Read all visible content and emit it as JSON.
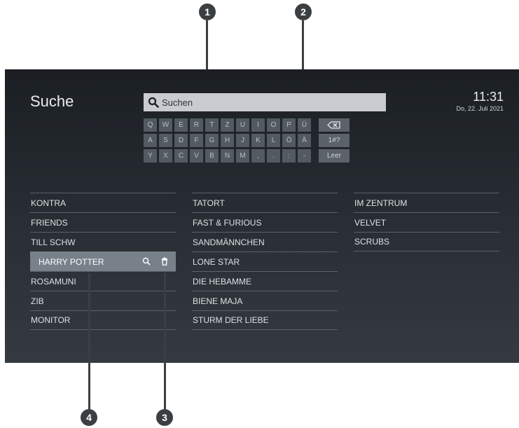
{
  "screen": {
    "title": "Suche",
    "clock": {
      "time": "11:31",
      "date": "Do, 22. Juli 2021"
    },
    "search": {
      "placeholder": "Suchen",
      "icon": "search-icon"
    },
    "keyboard": {
      "rows": [
        [
          "Q",
          "W",
          "E",
          "R",
          "T",
          "Z",
          "U",
          "I",
          "O",
          "P",
          "Ü"
        ],
        [
          "A",
          "S",
          "D",
          "F",
          "G",
          "H",
          "J",
          "K",
          "L",
          "Ö",
          "Ä"
        ],
        [
          "Y",
          "X",
          "C",
          "V",
          "B",
          "N",
          "M",
          ",",
          ".",
          ":",
          "-"
        ]
      ],
      "backspace_icon": "backspace-icon",
      "symbols_label": "1#?",
      "space_label": "Leer"
    },
    "history": {
      "col1": [
        "KONTRA",
        "FRIENDS",
        "TILL SCHW",
        "HARRY POTTER",
        "ROSAMUNI",
        "ZIB",
        "MONITOR"
      ],
      "col2": [
        "TATORT",
        "FAST & FURIOUS",
        "SANDMÄNNCHEN",
        "LONE STAR",
        "DIE HEBAMME",
        "BIENE MAJA",
        "STURM DER LIEBE"
      ],
      "col3": [
        "IM ZENTRUM",
        "VELVET",
        "SCRUBS"
      ],
      "selected": "HARRY POTTER"
    }
  },
  "callouts": [
    "1",
    "2",
    "3",
    "4"
  ]
}
